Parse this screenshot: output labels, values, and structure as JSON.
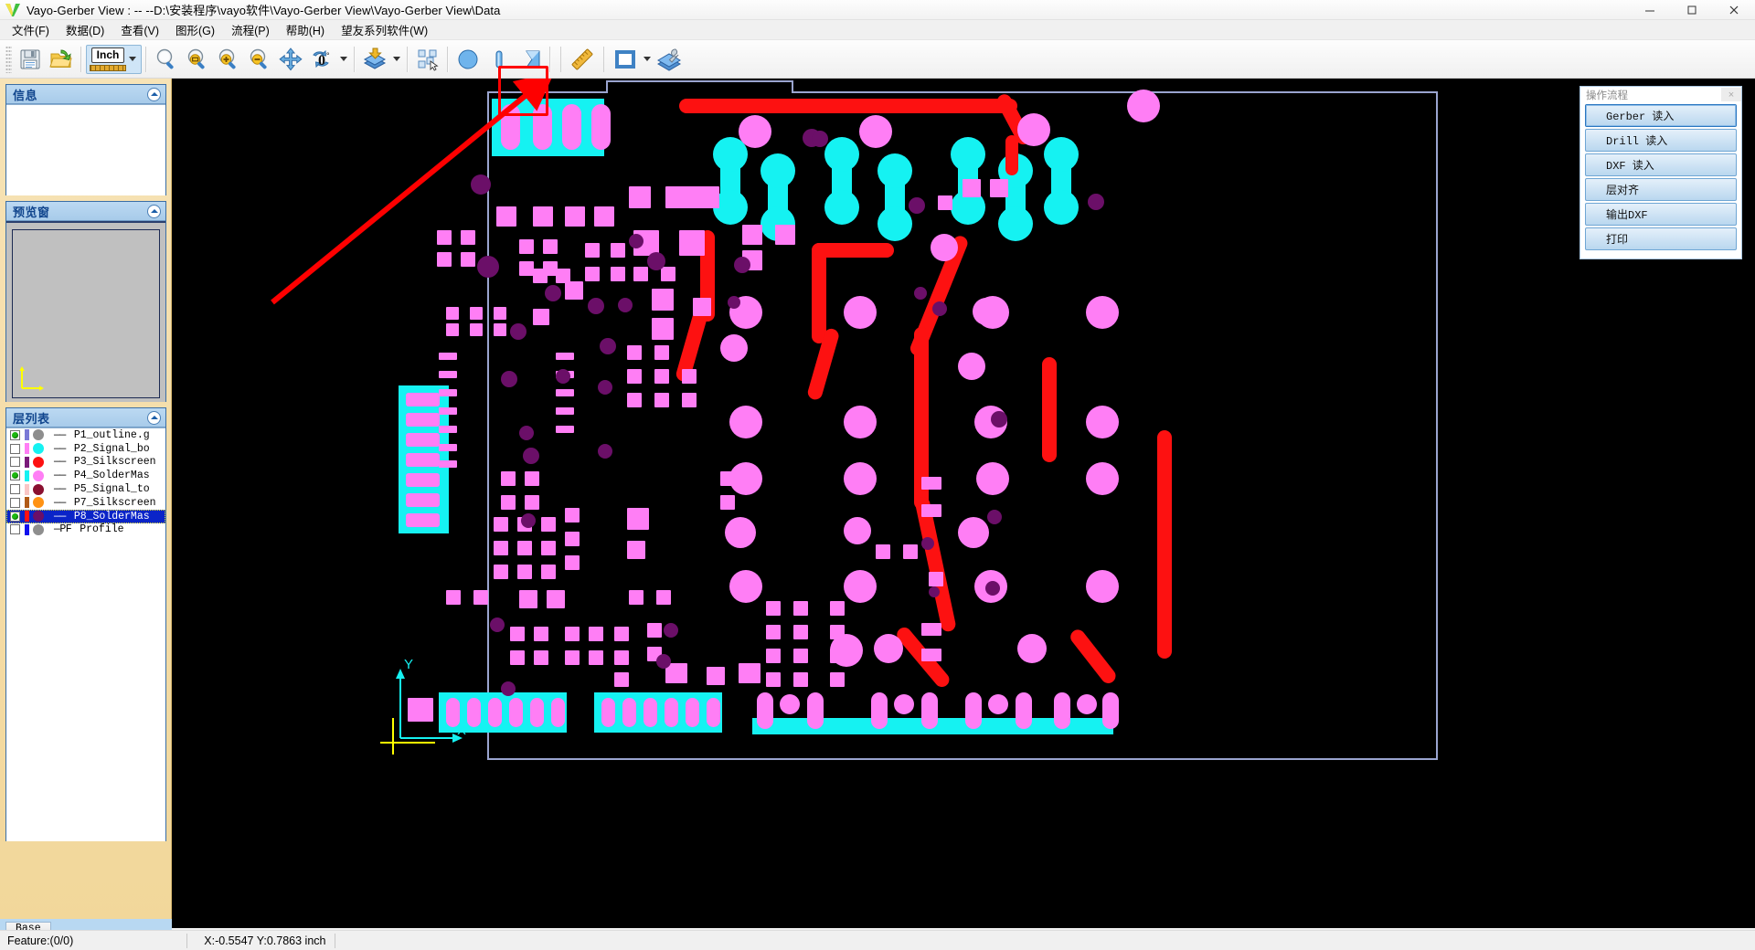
{
  "window": {
    "title": "Vayo-Gerber View :  --  --D:\\安装程序\\vayo软件\\Vayo-Gerber View\\Vayo-Gerber View\\Data",
    "minimize": "—",
    "maximize": "▢",
    "close": "✕"
  },
  "menu": [
    {
      "label": "文件(F)",
      "name": "menu-file"
    },
    {
      "label": "数据(D)",
      "name": "menu-data"
    },
    {
      "label": "查看(V)",
      "name": "menu-view"
    },
    {
      "label": "图形(G)",
      "name": "menu-graphics"
    },
    {
      "label": "流程(P)",
      "name": "menu-process"
    },
    {
      "label": "帮助(H)",
      "name": "menu-help"
    },
    {
      "label": "望友系列软件(W)",
      "name": "menu-vayo-suite"
    }
  ],
  "toolbar": {
    "unit_label": "Inch",
    "rotate_label": "0",
    "rotate_degree": "°",
    "items": [
      {
        "name": "save-icon",
        "tip": "保存"
      },
      {
        "name": "open-folder-icon",
        "tip": "打开"
      },
      {
        "name": "unit-inch-selector",
        "tip": "单位"
      },
      {
        "name": "zoom-icon",
        "tip": "缩放"
      },
      {
        "name": "zoom-window-icon",
        "tip": "窗口缩放"
      },
      {
        "name": "zoom-in-icon",
        "tip": "放大"
      },
      {
        "name": "zoom-out-icon",
        "tip": "缩小"
      },
      {
        "name": "pan-icon",
        "tip": "平移"
      },
      {
        "name": "rotate-icon",
        "tip": "旋转"
      },
      {
        "name": "layer-import-icon",
        "tip": "层导入"
      },
      {
        "name": "select-objects-icon",
        "tip": "选择"
      },
      {
        "name": "circle-shape-icon",
        "tip": "圆形"
      },
      {
        "name": "line-shape-icon",
        "tip": "线段"
      },
      {
        "name": "polygon-shape-icon",
        "tip": "多边形"
      },
      {
        "name": "ruler-measure-icon",
        "tip": "测量"
      },
      {
        "name": "rectangle-shape-icon",
        "tip": "矩形"
      },
      {
        "name": "layer-settings-icon",
        "tip": "层设置"
      }
    ]
  },
  "panels": {
    "info": {
      "title": "信息",
      "collapse": "⌃"
    },
    "preview": {
      "title": "预览窗",
      "collapse": "⌃"
    },
    "layers": {
      "title": "层列表",
      "collapse": "⌃"
    }
  },
  "layers": [
    {
      "visible": true,
      "bar": "#7a79d6",
      "circle": "#8e8e8e",
      "code": "——",
      "name": "P1_outline.g",
      "selected": false
    },
    {
      "visible": false,
      "bar": "#ff7ef5",
      "circle": "#15f2f2",
      "code": "——",
      "name": "P2_Signal_bo",
      "selected": false
    },
    {
      "visible": false,
      "bar": "#7a1a7a",
      "circle": "#fd1111",
      "code": "——",
      "name": "P3_Silkscreen",
      "selected": false
    },
    {
      "visible": true,
      "bar": "#15f2f2",
      "circle": "#ff7ef5",
      "code": "——",
      "name": "P4_SolderMas",
      "selected": false
    },
    {
      "visible": false,
      "bar": "#f9c6c6",
      "circle": "#8a1030",
      "code": "——",
      "name": "P5_Signal_to",
      "selected": false
    },
    {
      "visible": false,
      "bar": "#b05a17",
      "circle": "#ff9214",
      "code": "——",
      "name": "P7_Silkscreen",
      "selected": false
    },
    {
      "visible": true,
      "bar": "#fd1111",
      "circle": "#6b0f68",
      "code": "——",
      "name": "P8_SolderMas",
      "selected": true
    },
    {
      "visible": false,
      "bar": "#1111ee",
      "circle": "#8e8e8e",
      "code": "—PF",
      "name": "Profile",
      "selected": false
    }
  ],
  "base_tab": {
    "label": "Base"
  },
  "flow": {
    "title": "操作流程",
    "close": "×",
    "buttons": [
      {
        "label": "Gerber 读入",
        "name": "flow-gerber-import",
        "active": true
      },
      {
        "label": "Drill 读入",
        "name": "flow-drill-import",
        "active": false
      },
      {
        "label": "DXF 读入",
        "name": "flow-dxf-import",
        "active": false
      },
      {
        "label": "层对齐",
        "name": "flow-layer-align",
        "active": false
      },
      {
        "label": "输出DXF",
        "name": "flow-export-dxf",
        "active": false
      },
      {
        "label": "打印",
        "name": "flow-print",
        "active": false
      }
    ]
  },
  "status": {
    "feature": "Feature:(0/0)",
    "coords": "X:-0.5547 Y:0.7863 inch"
  },
  "colors": {
    "pad": "#ff7ef5",
    "drill": "#6b0f68",
    "mask": "#15f2f2",
    "trace": "#fd1111",
    "outline": "#9aa4cf",
    "annotation": "#fe0000",
    "axis": "#ffff00"
  }
}
